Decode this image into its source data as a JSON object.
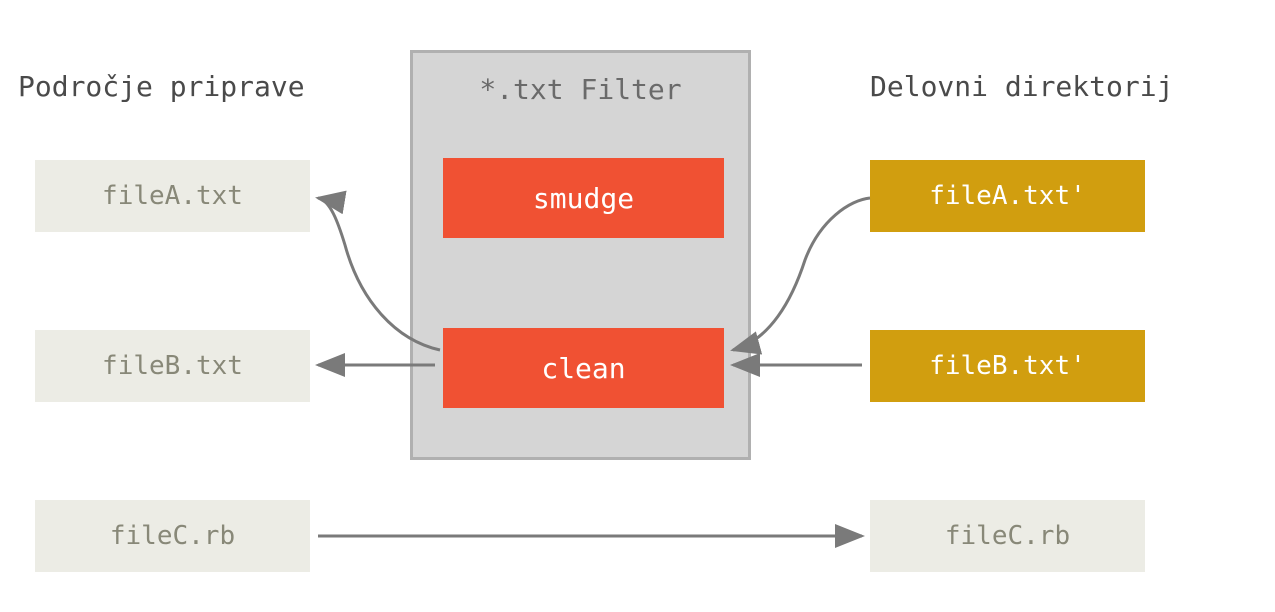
{
  "headers": {
    "left": "Področje priprave",
    "center": "*.txt Filter",
    "right": "Delovni direktorij"
  },
  "filter": {
    "smudge": "smudge",
    "clean": "clean"
  },
  "left_files": {
    "fileA": "fileA.txt",
    "fileB": "fileB.txt",
    "fileC": "fileC.rb"
  },
  "right_files": {
    "fileA": "fileA.txt'",
    "fileB": "fileB.txt'",
    "fileC": "fileC.rb"
  },
  "colors": {
    "gray_bg": "#ecece5",
    "gray_text": "#888878",
    "gold_bg": "#d19e0f",
    "filter_bg": "#d5d5d5",
    "filter_border": "#b0b0b0",
    "orange": "#f05133",
    "arrow": "#7a7a7a"
  }
}
